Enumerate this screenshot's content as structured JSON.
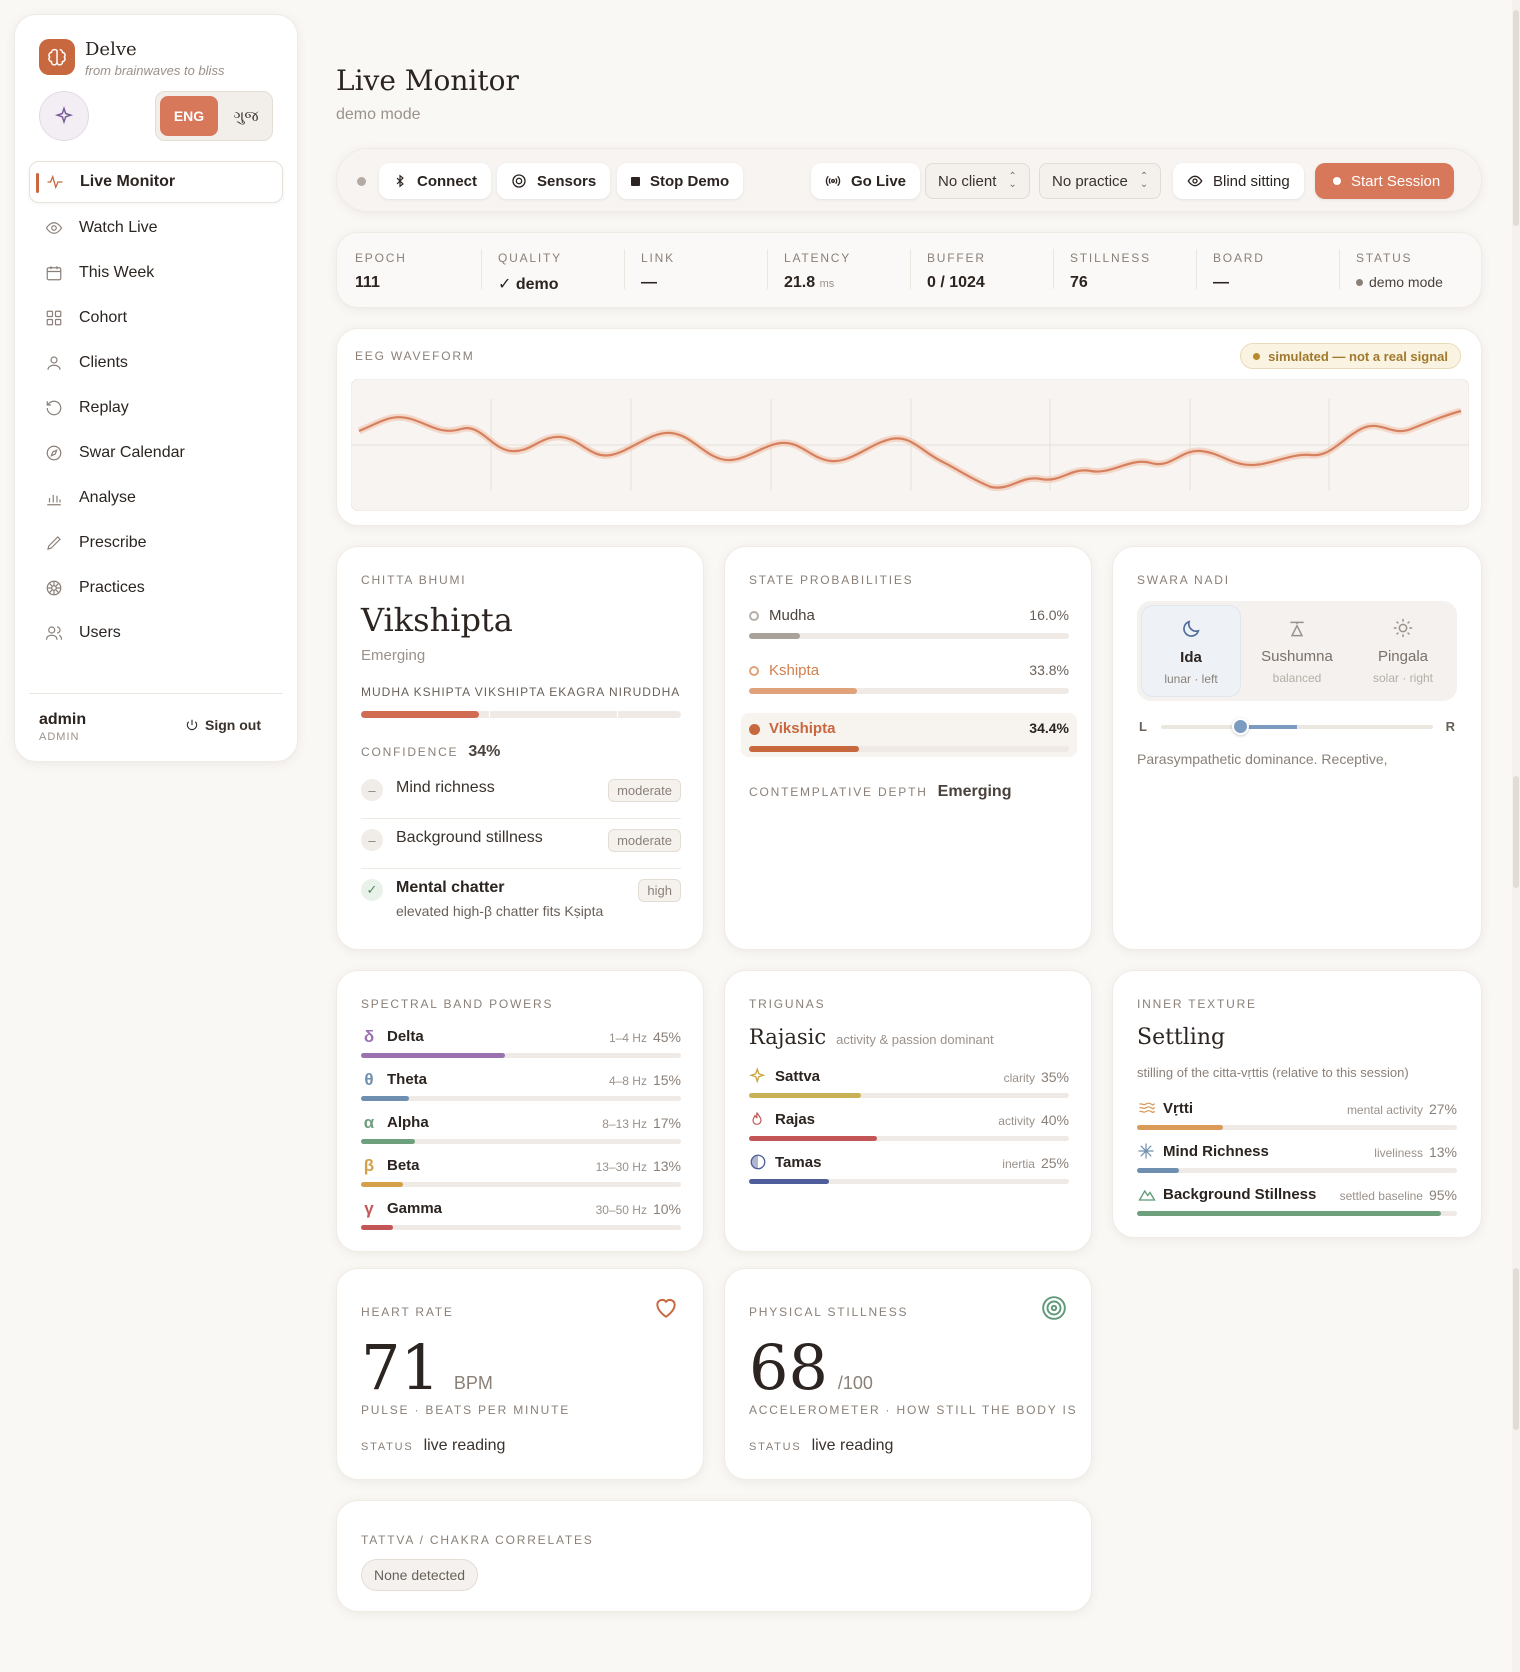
{
  "app": {
    "name": "Delve",
    "tagline": "from brainwaves to bliss"
  },
  "lang": {
    "eng": "ENG",
    "guj": "ગુજ"
  },
  "sidebar": {
    "items": [
      {
        "label": "Live Monitor",
        "icon": "activity-icon"
      },
      {
        "label": "Watch Live",
        "icon": "eye-icon"
      },
      {
        "label": "This Week",
        "icon": "calendar-icon"
      },
      {
        "label": "Cohort",
        "icon": "grid-icon"
      },
      {
        "label": "Clients",
        "icon": "user-icon"
      },
      {
        "label": "Replay",
        "icon": "history-icon"
      },
      {
        "label": "Swar Calendar",
        "icon": "compass-icon"
      },
      {
        "label": "Analyse",
        "icon": "bar-chart-icon"
      },
      {
        "label": "Prescribe",
        "icon": "pen-icon"
      },
      {
        "label": "Practices",
        "icon": "wheel-icon"
      },
      {
        "label": "Users",
        "icon": "users-icon"
      }
    ],
    "user": "admin",
    "role": "ADMIN",
    "signout": "Sign out"
  },
  "header": {
    "title": "Live Monitor",
    "subtitle": "demo mode"
  },
  "toolbar": {
    "connect": "Connect",
    "sensors": "Sensors",
    "stop_demo": "Stop Demo",
    "go_live": "Go Live",
    "client": "No client",
    "practice": "No practice",
    "blind": "Blind sitting",
    "start": "Start Session"
  },
  "stats": [
    {
      "label": "EPOCH",
      "value": "111"
    },
    {
      "label": "QUALITY",
      "value": "✓ demo"
    },
    {
      "label": "LINK",
      "value": "—"
    },
    {
      "label": "LATENCY",
      "value": "21.8",
      "unit": "ms"
    },
    {
      "label": "BUFFER",
      "value": "0 / 1024"
    },
    {
      "label": "STILLNESS",
      "value": "76"
    },
    {
      "label": "BOARD",
      "value": "—"
    },
    {
      "label": "STATUS",
      "value": "demo mode"
    }
  ],
  "eeg": {
    "title": "EEG WAVEFORM",
    "badge": "simulated — not a real signal"
  },
  "chitta": {
    "title": "CHITTA BHUMI",
    "state": "Vikshipta",
    "sub": "Emerging",
    "scale": "MUDHA KSHIPTA VIKSHIPTA EKAGRA NIRUDDHA",
    "level": 0.37,
    "confidence_label": "CONFIDENCE",
    "confidence": "34%",
    "items": [
      {
        "label": "Mind richness",
        "tag": "moderate",
        "mark": "–"
      },
      {
        "label": "Background stillness",
        "tag": "moderate",
        "mark": "–"
      },
      {
        "label": "Mental chatter",
        "tag": "high",
        "mark": "✓",
        "note": "elevated high-β chatter fits Kṣipta"
      }
    ]
  },
  "probs": {
    "title": "STATE PROBABILITIES",
    "items": [
      {
        "label": "Mudha",
        "pct": "16.0%",
        "value": 16.0,
        "color": "#a9a29b"
      },
      {
        "label": "Kshipta",
        "pct": "33.8%",
        "value": 33.8,
        "color": "#e0a27a"
      },
      {
        "label": "Vikshipta",
        "pct": "34.4%",
        "value": 34.4,
        "color": "#c8683f"
      }
    ],
    "depth_label": "CONTEMPLATIVE DEPTH",
    "depth": "Emerging"
  },
  "swara": {
    "title": "SWARA NADI",
    "tabs": [
      {
        "label": "Ida",
        "sub": "lunar · left"
      },
      {
        "label": "Sushumna",
        "sub": "balanced"
      },
      {
        "label": "Pingala",
        "sub": "solar · right"
      }
    ],
    "l": "L",
    "r": "R",
    "position": 0.29,
    "desc": "Parasympathetic dominance. Receptive,"
  },
  "bands": {
    "title": "SPECTRAL BAND POWERS",
    "items": [
      {
        "sym": "δ",
        "label": "Delta",
        "range": "1–4 Hz",
        "pct": "45%",
        "value": 45,
        "color": "#9b72b0"
      },
      {
        "sym": "θ",
        "label": "Theta",
        "range": "4–8 Hz",
        "pct": "15%",
        "value": 15,
        "color": "#6f8fb0"
      },
      {
        "sym": "α",
        "label": "Alpha",
        "range": "8–13 Hz",
        "pct": "17%",
        "value": 17,
        "color": "#6fa07d"
      },
      {
        "sym": "β",
        "label": "Beta",
        "range": "13–30 Hz",
        "pct": "13%",
        "value": 13,
        "color": "#d4a04a"
      },
      {
        "sym": "γ",
        "label": "Gamma",
        "range": "30–50 Hz",
        "pct": "10%",
        "value": 10,
        "color": "#c25656"
      }
    ]
  },
  "gunas": {
    "title": "TRIGUNAS",
    "dominant": "Rajasic",
    "dominant_note": "activity & passion dominant",
    "items": [
      {
        "label": "Sattva",
        "desc": "clarity",
        "pct": "35%",
        "value": 35,
        "color": "#c9b256",
        "icon": "sparkle-icon"
      },
      {
        "label": "Rajas",
        "desc": "activity",
        "pct": "40%",
        "value": 40,
        "color": "#c25656",
        "icon": "flame-icon"
      },
      {
        "label": "Tamas",
        "desc": "inertia",
        "pct": "25%",
        "value": 25,
        "color": "#4f5e9a",
        "icon": "half-circle-icon"
      }
    ]
  },
  "texture": {
    "title": "INNER TEXTURE",
    "state": "Settling",
    "sub": "stilling of the citta-vṛttis (relative to this session)",
    "items": [
      {
        "label": "Vṛtti",
        "desc": "mental activity",
        "pct": "27%",
        "value": 27,
        "color": "#d99a5a",
        "icon": "waves-icon"
      },
      {
        "label": "Mind Richness",
        "desc": "liveliness",
        "pct": "13%",
        "value": 13,
        "color": "#6f8fb0",
        "icon": "snowflake-icon"
      },
      {
        "label": "Background Stillness",
        "desc": "settled baseline",
        "pct": "95%",
        "value": 95,
        "color": "#6fa07d",
        "icon": "mountain-icon"
      }
    ]
  },
  "heart": {
    "title": "HEART RATE",
    "value": "71",
    "unit": "BPM",
    "desc": "PULSE · BEATS PER MINUTE",
    "status_label": "STATUS",
    "status": "live reading"
  },
  "still": {
    "title": "PHYSICAL STILLNESS",
    "value": "68",
    "unit": "/100",
    "desc": "ACCELEROMETER · HOW STILL THE BODY IS",
    "status_label": "STATUS",
    "status": "live reading"
  },
  "tattva": {
    "title": "TATTVA / CHAKRA CORRELATES",
    "chip": "None detected"
  },
  "colors": {
    "accent": "#c8683f",
    "bg": "#faf8f5"
  }
}
